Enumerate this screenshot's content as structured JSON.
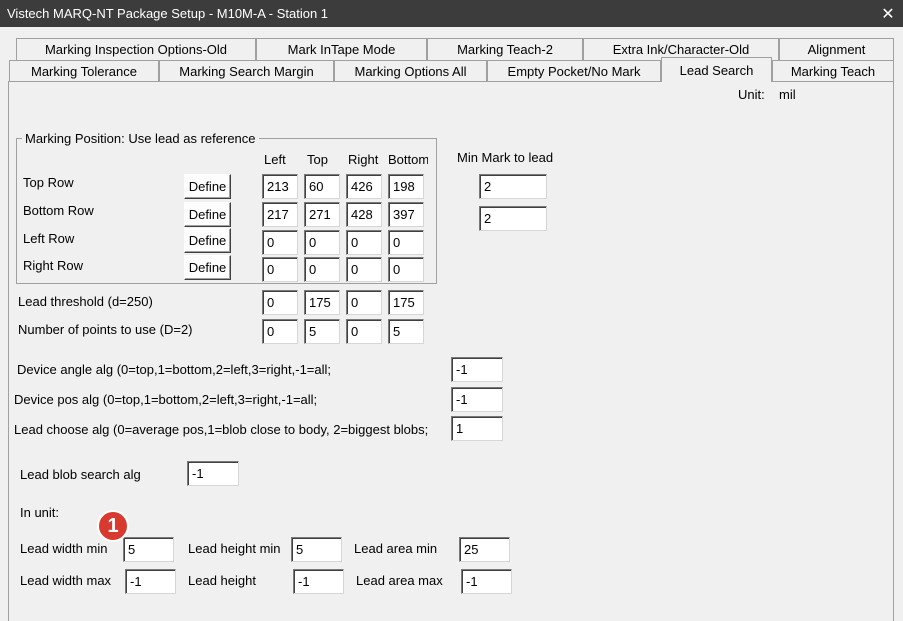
{
  "window": {
    "title": "Vistech MARQ-NT Package Setup - M10M-A - Station 1",
    "close_glyph": "✕"
  },
  "tabs_back": [
    "Marking Inspection Options-Old",
    "Mark InTape Mode",
    "Marking Teach-2",
    "Extra Ink/Character-Old",
    "Alignment"
  ],
  "tabs_front": [
    "Marking Tolerance",
    "Marking Search Margin",
    "Marking Options All",
    "Empty Pocket/No Mark",
    "Lead Search",
    "Marking Teach"
  ],
  "active_tab": "Lead Search",
  "unit": {
    "label": "Unit:",
    "value": "mil"
  },
  "marking_position": {
    "title": "Marking Position: Use lead as reference",
    "columns": [
      "Left",
      "Top",
      "Right",
      "Bottom"
    ],
    "define_label": "Define",
    "rows": [
      {
        "label": "Top Row",
        "values": [
          "213",
          "60",
          "426",
          "198"
        ]
      },
      {
        "label": "Bottom Row",
        "values": [
          "217",
          "271",
          "428",
          "397"
        ]
      },
      {
        "label": "Left Row",
        "values": [
          "0",
          "0",
          "0",
          "0"
        ]
      },
      {
        "label": "Right Row",
        "values": [
          "0",
          "0",
          "0",
          "0"
        ]
      }
    ]
  },
  "min_mark": {
    "label": "Min Mark to lead",
    "values": [
      "2",
      "2"
    ]
  },
  "lead_threshold": {
    "label": "Lead threshold (d=250)",
    "values": [
      "0",
      "175",
      "0",
      "175"
    ]
  },
  "num_points": {
    "label": "Number of points to use (D=2)",
    "values": [
      "0",
      "5",
      "0",
      "5"
    ]
  },
  "device_angle": {
    "label": "Device angle alg (0=top,1=bottom,2=left,3=right,-1=all;",
    "value": "-1"
  },
  "device_pos": {
    "label": "Device pos alg (0=top,1=bottom,2=left,3=right,-1=all;",
    "value": "-1"
  },
  "lead_choose": {
    "label": "Lead choose alg (0=average pos,1=blob close to body, 2=biggest blobs;",
    "value": "1"
  },
  "lead_blob": {
    "label": "Lead blob search alg",
    "value": "-1"
  },
  "in_unit": {
    "label": "In unit:"
  },
  "lead_width_min": {
    "label": "Lead width min",
    "value": "5"
  },
  "lead_height_min": {
    "label": "Lead height min",
    "value": "5"
  },
  "lead_area_min": {
    "label": "Lead area min",
    "value": "25"
  },
  "lead_width_max": {
    "label": "Lead width max",
    "value": "-1"
  },
  "lead_height": {
    "label": "Lead height",
    "value": "-1"
  },
  "lead_area_max": {
    "label": "Lead area max",
    "value": "-1"
  },
  "annotation": {
    "number": "1",
    "color": "#d93a30"
  },
  "colors": {
    "titlebar": "#3c3c3c",
    "background": "#f0f0f0",
    "badge": "#d93a30"
  }
}
